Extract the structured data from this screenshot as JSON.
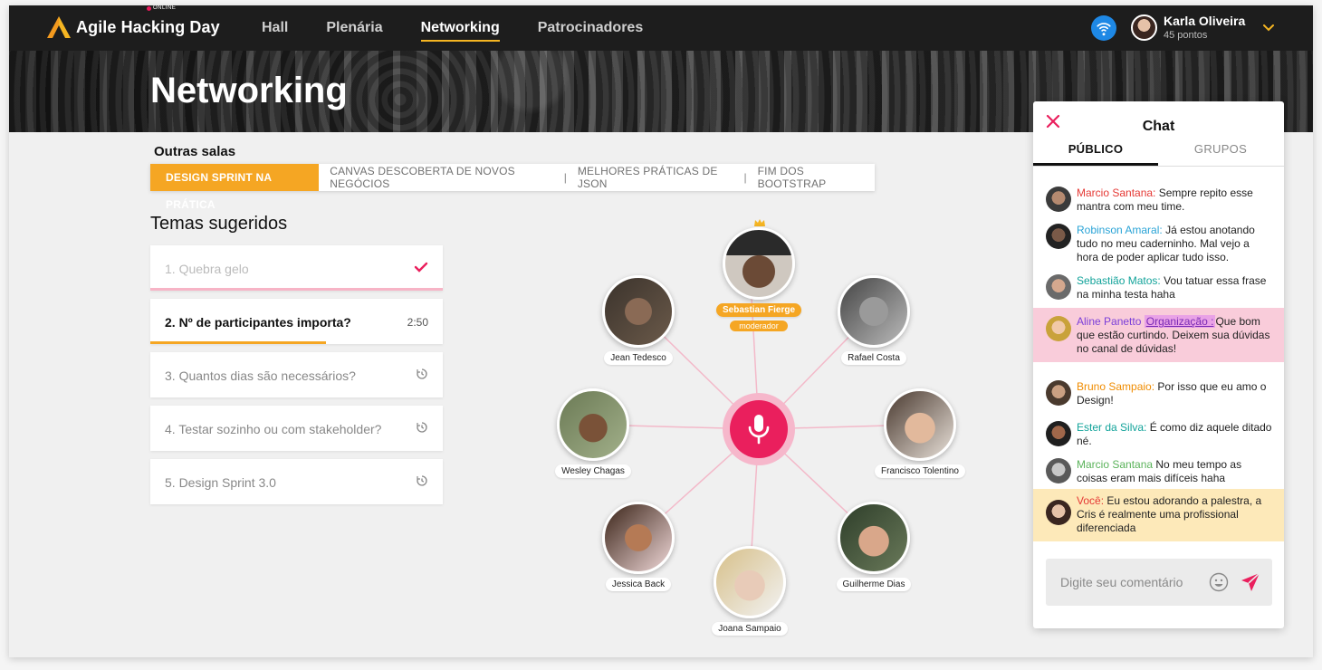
{
  "app": {
    "brand": "Agile Hacking Day",
    "brand_badge": "ONLINE",
    "nav": [
      {
        "label": "Hall",
        "active": false
      },
      {
        "label": "Plenária",
        "active": false
      },
      {
        "label": "Networking",
        "active": true
      },
      {
        "label": "Patrocinadores",
        "active": false
      }
    ],
    "user": {
      "name": "Karla Oliveira",
      "points": "45 pontos"
    },
    "accent": "#f5a623",
    "primary": "#ea1f5d"
  },
  "hero": {
    "title": "Networking"
  },
  "rooms": {
    "title": "Outras salas",
    "active": "DESIGN SPRINT NA PRÁTICA",
    "items": [
      "CANVAS DESCOBERTA DE NOVOS NEGÓCIOS",
      "MELHORES PRÁTICAS DE JSON",
      "FIM DOS BOOTSTRAP"
    ]
  },
  "topics": {
    "title": "Temas sugeridos",
    "items": [
      {
        "label": "1. Quebra gelo",
        "status": "done"
      },
      {
        "label": "2. Nº de participantes importa?",
        "status": "current",
        "time": "2:50",
        "progress": 0.6
      },
      {
        "label": "3. Quantos dias são necessários?",
        "status": "pending"
      },
      {
        "label": "4. Testar sozinho ou com stakeholder?",
        "status": "pending"
      },
      {
        "label": "5. Design Sprint 3.0",
        "status": "pending"
      }
    ]
  },
  "network": {
    "moderator": {
      "name": "Sebastian Fierge",
      "badge": "moderador"
    },
    "participants": [
      "Jean Tedesco",
      "Rafael Costa",
      "Wesley Chagas",
      "Francisco Tolentino",
      "Jessica Back",
      "Guilherme Dias",
      "Joana Sampaio"
    ]
  },
  "chat": {
    "title": "Chat",
    "tabs": [
      "PÚBLICO",
      "GRUPOS"
    ],
    "messages": [
      {
        "author": "Marcio Santana:",
        "text": "Sempre repito esse mantra com meu time.",
        "color": "#e53935"
      },
      {
        "author": "Robinson Amaral:",
        "text": "Já estou anotando tudo no meu caderninho. Mal vejo a hora de poder aplicar tudo isso.",
        "color": "#29a3d6"
      },
      {
        "author": "Sebastião Matos:",
        "text": "Vou tatuar essa frase na minha testa haha",
        "color": "#12a39a"
      },
      {
        "author": "Aline Panetto",
        "tag": "Organização :",
        "text": "Que bom que estão curtindo. Deixem sua dúvidas no canal de dúvidas!",
        "color": "#7b3fd9"
      },
      {
        "author": "Bruno Sampaio:",
        "text": "Por isso que eu amo o Design!",
        "color": "#f08c00"
      },
      {
        "author": "Ester da Silva:",
        "text": "É como diz aquele ditado né.",
        "color": "#12a39a"
      },
      {
        "author": "Marcio Santana",
        "text": "No meu tempo as coisas eram mais difíceis haha",
        "color": "#5bb35b"
      },
      {
        "author": "Você:",
        "text": "Eu estou adorando a palestra, a Cris é realmente uma profissional diferenciada",
        "color": "#e53935"
      }
    ],
    "input_placeholder": "Digite seu comentário"
  }
}
